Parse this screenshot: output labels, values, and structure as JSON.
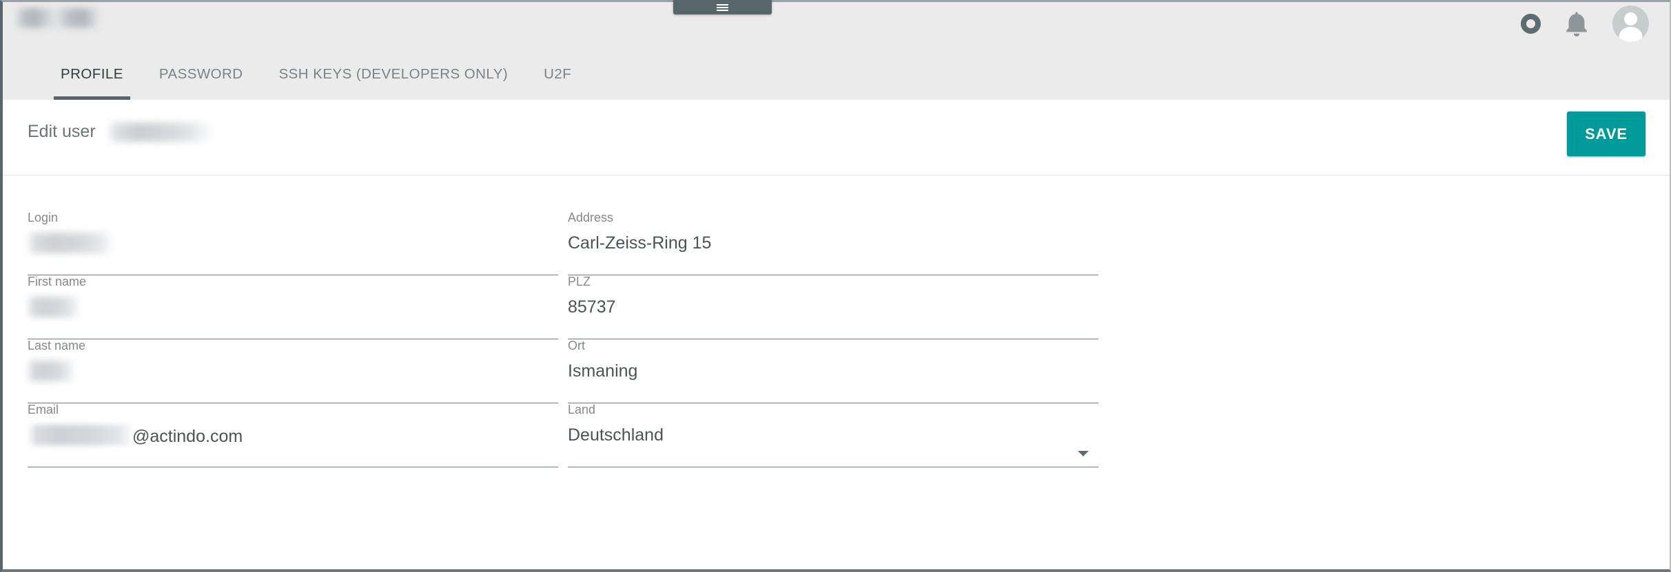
{
  "window": {
    "brand_title_redacted": "",
    "hamburger_icon": "hamburger-menu-icon"
  },
  "header": {
    "icons": [
      {
        "name": "ring-icon",
        "label": ""
      },
      {
        "name": "bell-icon",
        "label": ""
      },
      {
        "name": "avatar",
        "label": ""
      }
    ],
    "tabs": [
      {
        "label": "PROFILE",
        "active": true
      },
      {
        "label": "PASSWORD",
        "active": false
      },
      {
        "label": "SSH KEYS (DEVELOPERS ONLY)",
        "active": false
      },
      {
        "label": "U2F",
        "active": false
      }
    ]
  },
  "editbar": {
    "title": "Edit user",
    "username_redacted": "",
    "save_label": "SAVE",
    "save_color": "#009a9a"
  },
  "form": {
    "left": [
      {
        "label": "Login",
        "value": "",
        "redacted": true
      },
      {
        "label": "First name",
        "value": "",
        "redacted": true
      },
      {
        "label": "Last name",
        "value": "",
        "redacted": true
      },
      {
        "label": "Email",
        "value": "@actindo.com",
        "redacted": true
      }
    ],
    "right": [
      {
        "label": "Address",
        "value": "Carl-Zeiss-Ring 15",
        "redacted": false
      },
      {
        "label": "PLZ",
        "value": "85737",
        "redacted": false
      },
      {
        "label": "Ort",
        "value": "Ismaning",
        "redacted": false
      },
      {
        "label": "Land",
        "value": "Deutschland",
        "redacted": false,
        "dropdown": true
      }
    ]
  }
}
